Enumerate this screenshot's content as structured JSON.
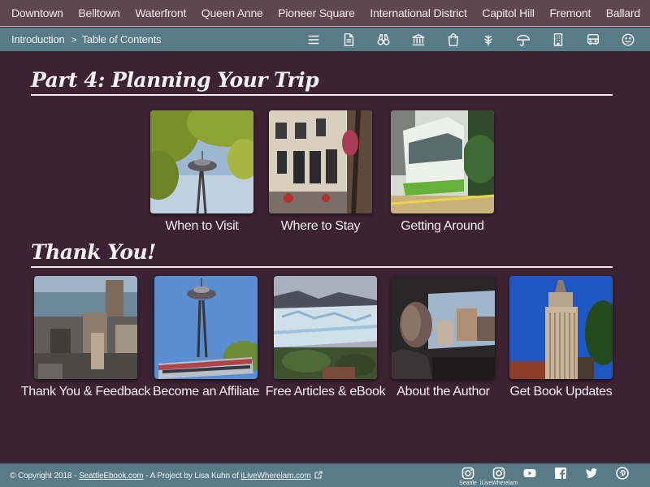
{
  "top_nav": [
    "Downtown",
    "Belltown",
    "Waterfront",
    "Queen Anne",
    "Pioneer Square",
    "International District",
    "Capitol Hill",
    "Fremont",
    "Ballard"
  ],
  "sub_nav": {
    "intro": "Introduction",
    "separator": ">",
    "toc": "Table of Contents",
    "icons": [
      "menu-icon",
      "document-icon",
      "binoculars-icon",
      "museum-icon",
      "shopping-bag-icon",
      "leaf-icon",
      "umbrella-icon",
      "building-icon",
      "bus-icon",
      "smiley-icon"
    ]
  },
  "sections": [
    {
      "title": "Part 4: Planning Your Trip",
      "tiles": [
        {
          "caption": "When to Visit",
          "image": "space-needle-trees-photo"
        },
        {
          "caption": "Where to Stay",
          "image": "hotel-building-photo"
        },
        {
          "caption": "Getting Around",
          "image": "streetcar-photo"
        }
      ]
    },
    {
      "title": "Thank You!",
      "tiles": [
        {
          "caption": "Thank You & Feedback",
          "image": "city-waterfront-photo"
        },
        {
          "caption": "Become an Affiliate",
          "image": "space-needle-monorail-photo"
        },
        {
          "caption": "Free Articles & eBook",
          "image": "glacier-photo"
        },
        {
          "caption": "About the Author",
          "image": "author-in-car-photo"
        },
        {
          "caption": "Get Book Updates",
          "image": "smith-tower-photo"
        }
      ]
    }
  ],
  "footer": {
    "copyright": "© Copyright 2018 - ",
    "site_link": "SeattleEbook.com",
    "middle": " - A Project by Lisa Kuhn of ",
    "author_link": "iLiveWherelam.com",
    "social": [
      {
        "icon": "instagram-icon",
        "label": "Seattle"
      },
      {
        "icon": "instagram-icon",
        "label": "iLiveWherelam"
      },
      {
        "icon": "youtube-icon",
        "label": ""
      },
      {
        "icon": "facebook-icon",
        "label": ""
      },
      {
        "icon": "twitter-icon",
        "label": ""
      },
      {
        "icon": "pinterest-icon",
        "label": ""
      }
    ]
  },
  "colors": {
    "background": "#3b2333",
    "top_nav": "#60464f",
    "bars": "#587b87",
    "text": "#f5eef2"
  }
}
